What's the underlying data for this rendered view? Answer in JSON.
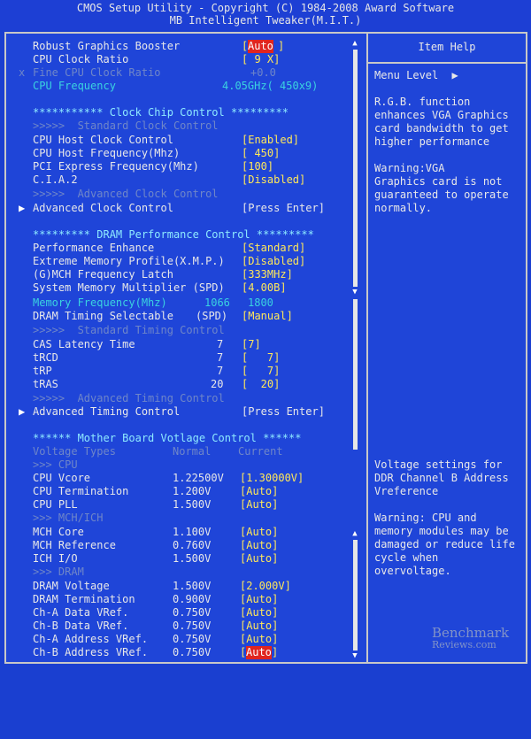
{
  "header": {
    "line1": "CMOS Setup Utility - Copyright (C) 1984-2008 Award Software",
    "line2": "MB Intelligent Tweaker(M.I.T.)"
  },
  "help": {
    "title": "Item Help",
    "menu_level": "Menu Level",
    "menu_level_arrow": "▶",
    "top_text": [
      "R.G.B. function",
      "enhances VGA Graphics",
      "card bandwidth to get",
      "higher performance"
    ],
    "top_warning": [
      "Warning:VGA",
      "Graphics card is not",
      "guaranteed to operate",
      "normally."
    ],
    "bottom_text": [
      "Voltage settings for",
      "DDR Channel B Address",
      "Vreference"
    ],
    "bottom_warning": [
      "Warning: CPU and",
      "memory modules may be",
      "damaged or reduce life",
      "cycle when",
      "overvoltage."
    ]
  },
  "watermark": {
    "line1": "Benchmark",
    "line2": "Reviews.com"
  },
  "rows": {
    "r01": {
      "label": "Robust Graphics Booster",
      "value": "Auto"
    },
    "r02": {
      "label": "CPU Clock Ratio",
      "value": "[ 9 X]"
    },
    "r03": {
      "prefix": "x",
      "label": "Fine CPU Clock Ratio",
      "value": "+0.0"
    },
    "r04": {
      "label": "CPU Frequency",
      "value": "4.05GHz( 450x9)"
    },
    "r05": {
      "label": "*********** Clock Chip Control *********"
    },
    "r06": {
      "label": ">>>>>  Standard Clock Control"
    },
    "r07": {
      "label": "CPU Host Clock Control",
      "value": "[Enabled]"
    },
    "r08": {
      "label": "CPU Host Frequency(Mhz)",
      "value": "[ 450]"
    },
    "r09": {
      "label": "PCI Express Frequency(Mhz)",
      "value": "[100]"
    },
    "r10": {
      "label": "C.I.A.2",
      "value": "[Disabled]"
    },
    "r11": {
      "label": ">>>>>  Advanced Clock Control"
    },
    "r12": {
      "label": "Advanced Clock Control",
      "value": "[Press Enter]"
    },
    "r13": {
      "label": "********* DRAM Performance Control *********"
    },
    "r14": {
      "label": "Performance Enhance",
      "value": "[Standard]"
    },
    "r15": {
      "label": "Extreme Memory Profile(X.M.P.)",
      "value": "[Disabled]"
    },
    "r16": {
      "label": "(G)MCH Frequency Latch",
      "value": "[333MHz]"
    },
    "r17": {
      "label": "System Memory Multiplier (SPD)",
      "value": "[4.00B]"
    },
    "r18": {
      "label": "Memory Frequency(Mhz)",
      "spd": "1066",
      "value": "1800"
    },
    "r19": {
      "label": "DRAM Timing Selectable",
      "spd": "(SPD)",
      "value": "[Manual]"
    },
    "r20": {
      "label": ">>>>>  Standard Timing Control"
    },
    "r21": {
      "label": "CAS Latency Time",
      "spd": "7",
      "value": "[7]"
    },
    "r22": {
      "label": "tRCD",
      "spd": "7",
      "value": "[   7]"
    },
    "r23": {
      "label": "tRP",
      "spd": "7",
      "value": "[   7]"
    },
    "r24": {
      "label": "tRAS",
      "spd": "20",
      "value": "[  20]"
    },
    "r25": {
      "label": ">>>>>  Advanced Timing Control"
    },
    "r26": {
      "label": "Advanced Timing Control",
      "value": "[Press Enter]"
    },
    "r27": {
      "label": "****** Mother Board Votlage Control ******"
    },
    "r28": {
      "label": "Voltage Types",
      "spd": "Normal",
      "value": "Current"
    },
    "r29": {
      "label": ">>> CPU"
    },
    "r30": {
      "label": "CPU Vcore",
      "spd": "1.22500V",
      "value": "[1.30000V]"
    },
    "r31": {
      "label": "CPU Termination",
      "spd": "1.200V",
      "value": "[Auto]"
    },
    "r32": {
      "label": "CPU PLL",
      "spd": "1.500V",
      "value": "[Auto]"
    },
    "r33": {
      "label": ">>> MCH/ICH"
    },
    "r34": {
      "label": "MCH Core",
      "spd": "1.100V",
      "value": "[Auto]"
    },
    "r35": {
      "label": "MCH Reference",
      "spd": "0.760V",
      "value": "[Auto]"
    },
    "r36": {
      "label": "ICH I/O",
      "spd": "1.500V",
      "value": "[Auto]"
    },
    "r37": {
      "label": ">>> DRAM"
    },
    "r38": {
      "label": "DRAM Voltage",
      "spd": "1.500V",
      "value": "[2.000V]"
    },
    "r39": {
      "label": "DRAM Termination",
      "spd": "0.900V",
      "value": "[Auto]"
    },
    "r40": {
      "label": "Ch-A Data VRef.",
      "spd": "0.750V",
      "value": "[Auto]"
    },
    "r41": {
      "label": "Ch-B Data VRef.",
      "spd": "0.750V",
      "value": "[Auto]"
    },
    "r42": {
      "label": "Ch-A Address VRef.",
      "spd": "0.750V",
      "value": "[Auto]"
    },
    "r43": {
      "label": "Ch-B Address VRef.",
      "spd": "0.750V",
      "value": "Auto"
    }
  }
}
